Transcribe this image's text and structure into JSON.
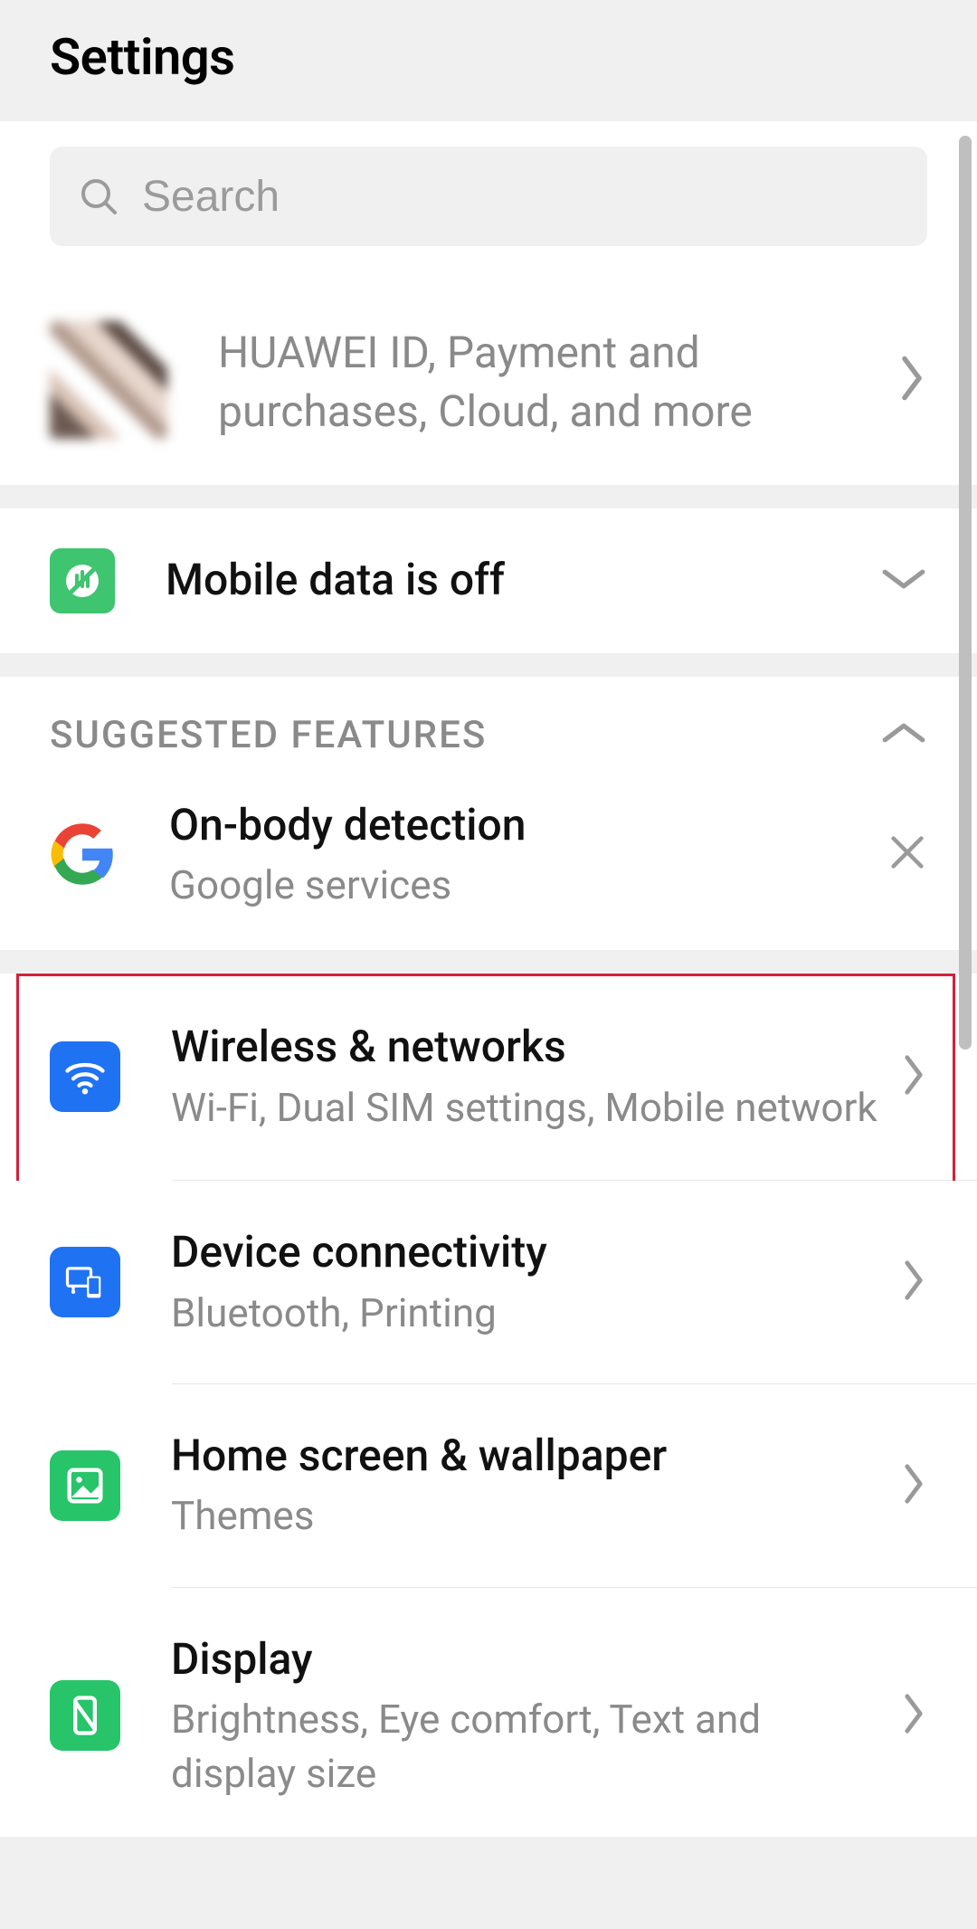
{
  "header": {
    "title": "Settings"
  },
  "search": {
    "placeholder": "Search"
  },
  "account": {
    "label": "HUAWEI ID, Payment and purchases, Cloud, and more"
  },
  "notice": {
    "label": "Mobile data is off"
  },
  "suggested": {
    "heading": "SUGGESTED FEATURES",
    "items": [
      {
        "title": "On-body detection",
        "sub": "Google services"
      }
    ]
  },
  "settings": [
    {
      "title": "Wireless & networks",
      "sub": "Wi-Fi, Dual SIM settings, Mobile network"
    },
    {
      "title": "Device connectivity",
      "sub": "Bluetooth, Printing"
    },
    {
      "title": "Home screen & wallpaper",
      "sub": "Themes"
    },
    {
      "title": "Display",
      "sub": "Brightness, Eye comfort, Text and display size"
    }
  ]
}
